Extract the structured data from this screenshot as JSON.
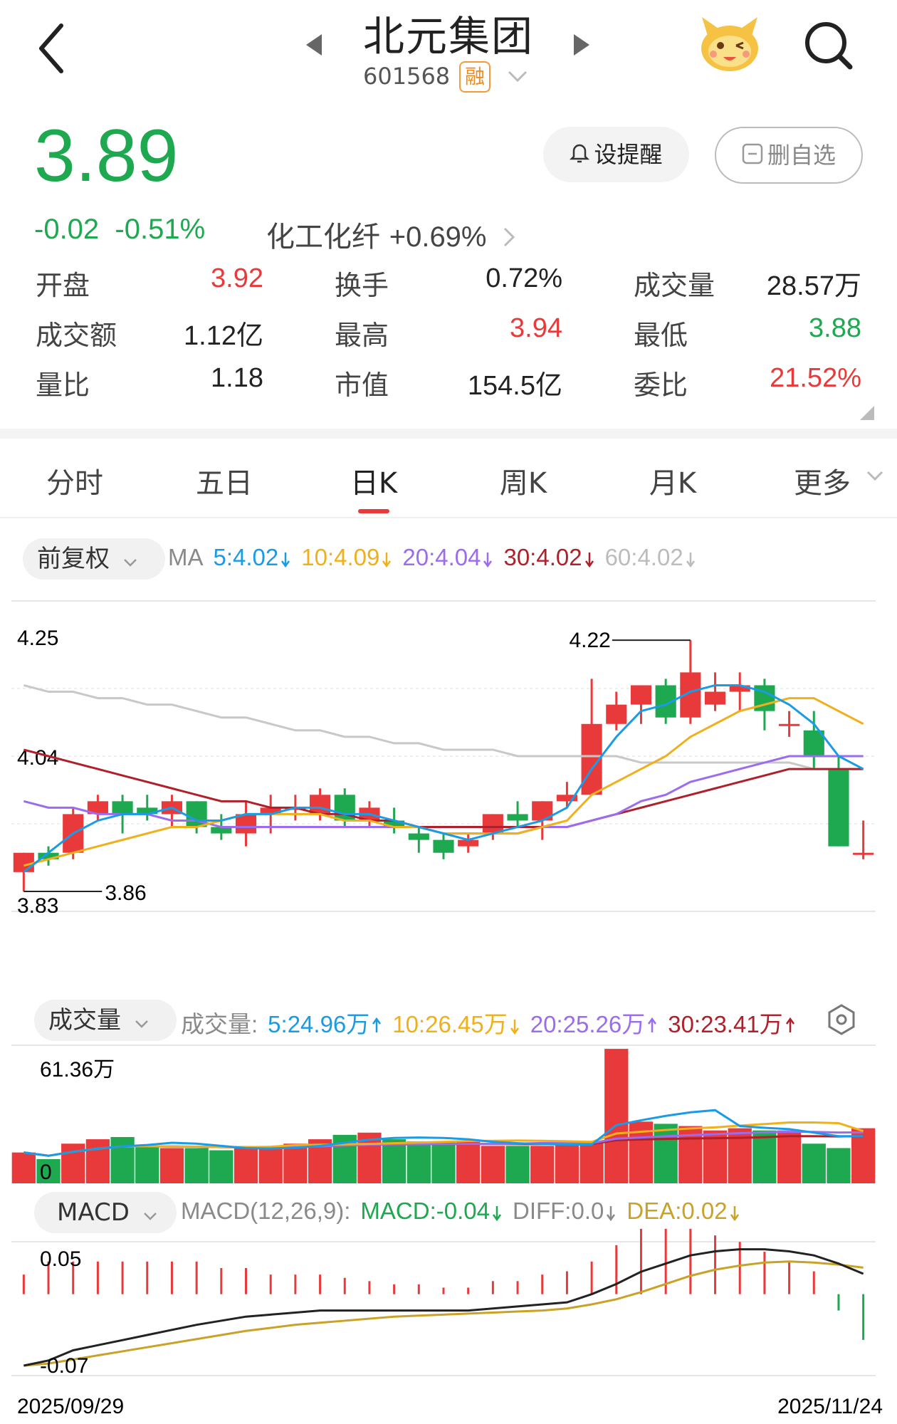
{
  "header": {
    "title": "北元集团",
    "code": "601568",
    "margin_badge": "融",
    "icons": [
      "back-icon",
      "prev-stock-icon",
      "next-stock-icon",
      "mascot-icon",
      "search-icon",
      "dropdown-icon"
    ]
  },
  "quote": {
    "price": "3.89",
    "change": "-0.02",
    "change_pct": "-0.51%",
    "sector": "化工化纤",
    "sector_change": "+0.69%",
    "remind_label": "设提醒",
    "remove_fav_label": "删自选"
  },
  "stats": [
    {
      "label": "开盘",
      "value": "3.92",
      "tone": "red"
    },
    {
      "label": "换手",
      "value": "0.72%",
      "tone": "neutral"
    },
    {
      "label": "成交量",
      "value": "28.57万",
      "tone": "neutral"
    },
    {
      "label": "成交额",
      "value": "1.12亿",
      "tone": "neutral"
    },
    {
      "label": "最高",
      "value": "3.94",
      "tone": "red"
    },
    {
      "label": "最低",
      "value": "3.88",
      "tone": "green"
    },
    {
      "label": "量比",
      "value": "1.18",
      "tone": "neutral"
    },
    {
      "label": "市值",
      "value": "154.5亿",
      "tone": "neutral"
    },
    {
      "label": "委比",
      "value": "21.52%",
      "tone": "red"
    }
  ],
  "tabs": [
    "分时",
    "五日",
    "日K",
    "周K",
    "月K",
    "更多"
  ],
  "active_tab": "日K",
  "ma_bar": {
    "adjust_label": "前复权",
    "prefix": "MA",
    "items": [
      {
        "text": "5:4.02",
        "color": "#1a9be6"
      },
      {
        "text": "10:4.09",
        "color": "#f0b01c"
      },
      {
        "text": "20:4.04",
        "color": "#9b6cf0"
      },
      {
        "text": "30:4.02",
        "color": "#b0202a"
      },
      {
        "text": "60:4.02",
        "color": "#bcbcbc"
      }
    ]
  },
  "vol_bar": {
    "label": "成交量",
    "prefix": "成交量:",
    "items": [
      {
        "text": "5:24.96万",
        "arrow": "up",
        "color": "#1a9be6"
      },
      {
        "text": "10:26.45万",
        "arrow": "down",
        "color": "#f0b01c"
      },
      {
        "text": "20:25.26万",
        "arrow": "up",
        "color": "#9b6cf0"
      },
      {
        "text": "30:23.41万",
        "arrow": "up",
        "color": "#b0202a"
      }
    ]
  },
  "macd_bar": {
    "label": "MACD",
    "prefix": "MACD(12,26,9):",
    "items": [
      {
        "text": "MACD:-0.04",
        "color": "#1ea84f"
      },
      {
        "text": "DIFF:0.0",
        "color": "#8a8a8a"
      },
      {
        "text": "DEA:0.02",
        "color": "#c9a227"
      }
    ]
  },
  "chart_data": {
    "type": "candlestick",
    "x_start_label": "2025/09/29",
    "x_end_label": "2025/11/24",
    "price_axis": {
      "top": "4.25",
      "mid": "4.04",
      "bottom": "3.83"
    },
    "price_range": [
      3.83,
      4.25
    ],
    "max_marker": "4.22",
    "min_marker": "3.86",
    "candles": [
      {
        "o": 3.86,
        "c": 3.89,
        "h": 3.89,
        "l": 3.83
      },
      {
        "o": 3.89,
        "c": 3.88,
        "h": 3.9,
        "l": 3.87
      },
      {
        "o": 3.89,
        "c": 3.95,
        "h": 3.96,
        "l": 3.88
      },
      {
        "o": 3.95,
        "c": 3.97,
        "h": 3.98,
        "l": 3.94
      },
      {
        "o": 3.97,
        "c": 3.95,
        "h": 3.98,
        "l": 3.92
      },
      {
        "o": 3.96,
        "c": 3.95,
        "h": 3.98,
        "l": 3.94
      },
      {
        "o": 3.95,
        "c": 3.97,
        "h": 3.98,
        "l": 3.93
      },
      {
        "o": 3.97,
        "c": 3.93,
        "h": 3.97,
        "l": 3.92
      },
      {
        "o": 3.93,
        "c": 3.92,
        "h": 3.95,
        "l": 3.91
      },
      {
        "o": 3.92,
        "c": 3.95,
        "h": 3.97,
        "l": 3.9
      },
      {
        "o": 3.95,
        "c": 3.96,
        "h": 3.98,
        "l": 3.92
      },
      {
        "o": 3.96,
        "c": 3.96,
        "h": 3.98,
        "l": 3.94
      },
      {
        "o": 3.95,
        "c": 3.98,
        "h": 3.99,
        "l": 3.94
      },
      {
        "o": 3.98,
        "c": 3.94,
        "h": 3.99,
        "l": 3.93
      },
      {
        "o": 3.94,
        "c": 3.96,
        "h": 3.97,
        "l": 3.93
      },
      {
        "o": 3.94,
        "c": 3.93,
        "h": 3.96,
        "l": 3.92
      },
      {
        "o": 3.92,
        "c": 3.91,
        "h": 3.93,
        "l": 3.89
      },
      {
        "o": 3.91,
        "c": 3.89,
        "h": 3.92,
        "l": 3.88
      },
      {
        "o": 3.9,
        "c": 3.91,
        "h": 3.92,
        "l": 3.89
      },
      {
        "o": 3.92,
        "c": 3.95,
        "h": 3.95,
        "l": 3.91
      },
      {
        "o": 3.95,
        "c": 3.94,
        "h": 3.97,
        "l": 3.93
      },
      {
        "o": 3.94,
        "c": 3.97,
        "h": 3.97,
        "l": 3.91
      },
      {
        "o": 3.97,
        "c": 3.98,
        "h": 4.0,
        "l": 3.96
      },
      {
        "o": 3.98,
        "c": 4.09,
        "h": 4.16,
        "l": 3.98
      },
      {
        "o": 4.09,
        "c": 4.12,
        "h": 4.14,
        "l": 4.08
      },
      {
        "o": 4.12,
        "c": 4.15,
        "h": 4.15,
        "l": 4.09
      },
      {
        "o": 4.15,
        "c": 4.1,
        "h": 4.16,
        "l": 4.09
      },
      {
        "o": 4.1,
        "c": 4.17,
        "h": 4.22,
        "l": 4.09
      },
      {
        "o": 4.12,
        "c": 4.14,
        "h": 4.17,
        "l": 4.11
      },
      {
        "o": 4.14,
        "c": 4.15,
        "h": 4.17,
        "l": 4.11
      },
      {
        "o": 4.15,
        "c": 4.11,
        "h": 4.16,
        "l": 4.08
      },
      {
        "o": 4.09,
        "c": 4.09,
        "h": 4.11,
        "l": 4.07
      },
      {
        "o": 4.08,
        "c": 4.04,
        "h": 4.11,
        "l": 4.02
      },
      {
        "o": 4.02,
        "c": 3.9,
        "h": 4.04,
        "l": 3.9
      },
      {
        "o": 3.89,
        "c": 3.89,
        "h": 3.94,
        "l": 3.88
      }
    ],
    "ma": {
      "ma5": [
        3.86,
        3.89,
        3.92,
        3.94,
        3.95,
        3.95,
        3.96,
        3.94,
        3.94,
        3.95,
        3.95,
        3.96,
        3.96,
        3.95,
        3.95,
        3.94,
        3.93,
        3.92,
        3.91,
        3.92,
        3.93,
        3.94,
        3.96,
        4.02,
        4.07,
        4.11,
        4.12,
        4.14,
        4.15,
        4.15,
        4.14,
        4.12,
        4.09,
        4.04,
        4.02
      ],
      "ma10": [
        3.87,
        3.88,
        3.89,
        3.9,
        3.91,
        3.92,
        3.93,
        3.93,
        3.94,
        3.95,
        3.95,
        3.95,
        3.95,
        3.94,
        3.94,
        3.93,
        3.93,
        3.92,
        3.92,
        3.92,
        3.92,
        3.93,
        3.94,
        3.98,
        4.0,
        4.02,
        4.04,
        4.07,
        4.09,
        4.11,
        4.12,
        4.13,
        4.13,
        4.11,
        4.09
      ],
      "ma20": [
        3.97,
        3.96,
        3.96,
        3.95,
        3.95,
        3.95,
        3.94,
        3.94,
        3.93,
        3.93,
        3.93,
        3.93,
        3.93,
        3.93,
        3.93,
        3.93,
        3.93,
        3.92,
        3.92,
        3.92,
        3.92,
        3.93,
        3.93,
        3.94,
        3.95,
        3.97,
        3.98,
        4.0,
        4.01,
        4.02,
        4.03,
        4.04,
        4.04,
        4.04,
        4.04
      ],
      "ma30": [
        4.05,
        4.04,
        4.03,
        4.02,
        4.01,
        4.0,
        3.99,
        3.98,
        3.97,
        3.97,
        3.96,
        3.96,
        3.95,
        3.95,
        3.94,
        3.94,
        3.93,
        3.93,
        3.93,
        3.93,
        3.93,
        3.93,
        3.93,
        3.94,
        3.95,
        3.96,
        3.97,
        3.98,
        3.99,
        4.0,
        4.01,
        4.02,
        4.02,
        4.02,
        4.02
      ],
      "ma60": [
        4.15,
        4.14,
        4.14,
        4.13,
        4.13,
        4.12,
        4.12,
        4.11,
        4.1,
        4.1,
        4.09,
        4.08,
        4.08,
        4.07,
        4.07,
        4.06,
        4.06,
        4.05,
        4.05,
        4.05,
        4.04,
        4.04,
        4.04,
        4.04,
        4.04,
        4.03,
        4.03,
        4.03,
        4.03,
        4.03,
        4.03,
        4.03,
        4.02,
        4.02,
        4.02
      ]
    },
    "volume_axis": {
      "top": "61.36万",
      "bottom": "0"
    },
    "volume_max": 61.36,
    "volume": [
      14,
      11,
      18,
      20,
      21,
      17,
      16,
      16,
      15,
      16,
      16,
      18,
      20,
      22,
      23,
      20,
      19,
      19,
      19,
      17,
      17,
      17,
      18,
      19,
      61,
      28,
      27,
      26,
      24,
      25,
      24,
      24,
      18,
      16,
      25,
      21
    ],
    "macd_axis": {
      "top": "0.05",
      "bottom": "-0.07"
    },
    "macd_range": [
      -0.07,
      0.05
    ],
    "diff": [
      -0.07,
      -0.065,
      -0.055,
      -0.05,
      -0.045,
      -0.04,
      -0.035,
      -0.03,
      -0.026,
      -0.022,
      -0.02,
      -0.018,
      -0.016,
      -0.016,
      -0.016,
      -0.016,
      -0.016,
      -0.016,
      -0.016,
      -0.014,
      -0.012,
      -0.01,
      -0.008,
      0.0,
      0.01,
      0.022,
      0.03,
      0.038,
      0.042,
      0.044,
      0.044,
      0.042,
      0.038,
      0.03,
      0.02
    ],
    "dea": [
      -0.07,
      -0.068,
      -0.064,
      -0.06,
      -0.056,
      -0.052,
      -0.048,
      -0.044,
      -0.04,
      -0.036,
      -0.033,
      -0.03,
      -0.028,
      -0.026,
      -0.024,
      -0.022,
      -0.021,
      -0.02,
      -0.019,
      -0.018,
      -0.017,
      -0.016,
      -0.014,
      -0.01,
      -0.005,
      0.002,
      0.01,
      0.018,
      0.024,
      0.028,
      0.031,
      0.032,
      0.031,
      0.029,
      0.026
    ],
    "macd_hist": [
      0.012,
      0.02,
      0.02,
      0.02,
      0.02,
      0.02,
      0.02,
      0.02,
      0.016,
      0.016,
      0.012,
      0.012,
      0.012,
      0.01,
      0.008,
      0.006,
      0.006,
      0.004,
      0.004,
      0.008,
      0.008,
      0.012,
      0.014,
      0.02,
      0.03,
      0.04,
      0.04,
      0.04,
      0.036,
      0.032,
      0.026,
      0.02,
      0.014,
      -0.01,
      -0.028
    ]
  }
}
